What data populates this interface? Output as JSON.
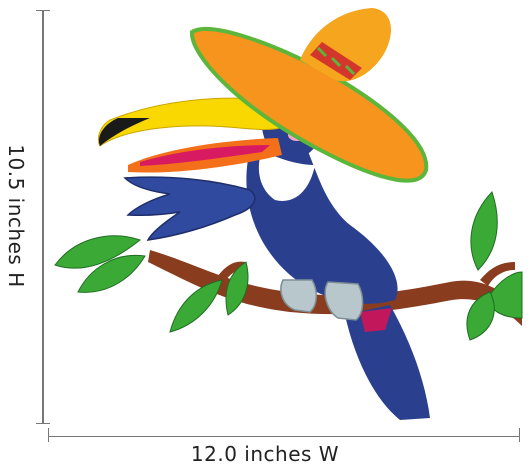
{
  "dimensions": {
    "height_label": "10.5 inches H",
    "width_label": "12.0 inches W"
  },
  "illustration": {
    "subject": "toucan-with-sombrero-on-branch",
    "colors": {
      "beak_yellow": "#f8d800",
      "beak_orange": "#f36f1a",
      "body_blue": "#2b3f8f",
      "hat_orange": "#f7941d",
      "hat_brim_green": "#5bb63b",
      "branch_brown": "#8a3c1f",
      "leaf_green": "#3aa935"
    }
  }
}
